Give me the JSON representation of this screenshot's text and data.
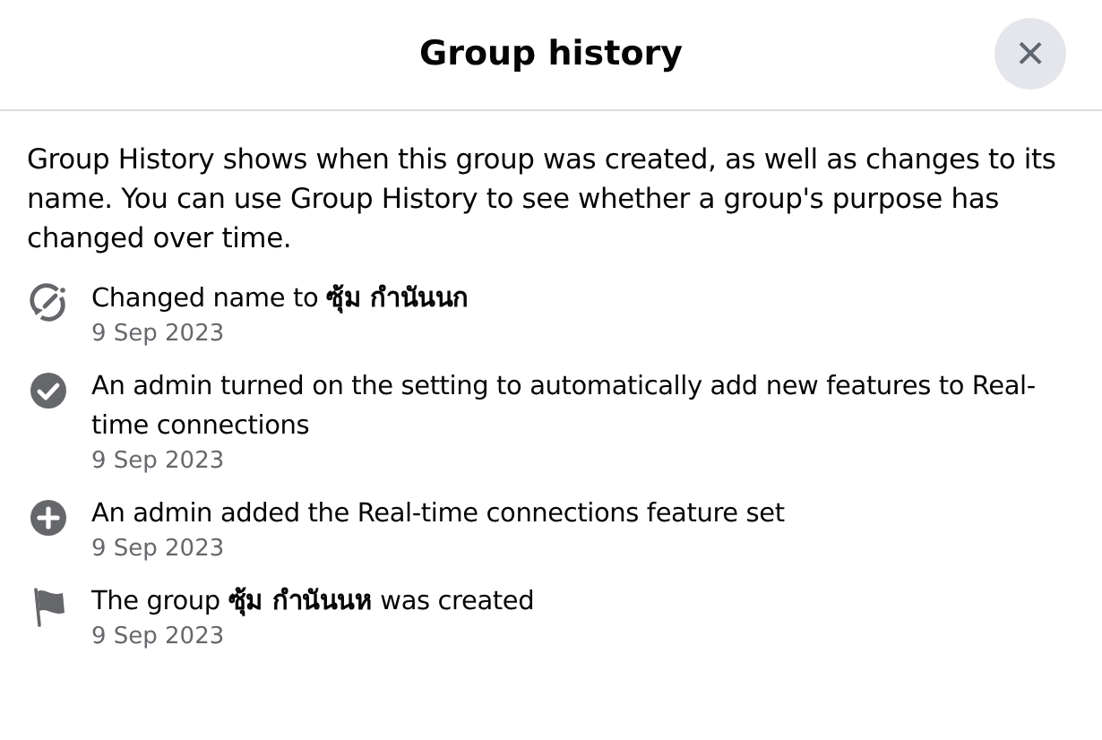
{
  "dialog": {
    "title": "Group history",
    "close_label": "×"
  },
  "description": "Group History shows when this group was created, as well as changes to its name. You can use Group History to see whether a group's purpose has changed over time.",
  "events": [
    {
      "kind": "rename",
      "text": "Changed name to **ซุ้ม กำนันนก**",
      "date": "9 Sep 2023"
    },
    {
      "kind": "check",
      "text": "An admin turned on the setting to automatically add new features to Real-time connections",
      "date": "9 Sep 2023"
    },
    {
      "kind": "add",
      "text": "An admin added the Real-time connections feature set",
      "date": "9 Sep 2023"
    },
    {
      "kind": "flag",
      "text": "The group **ซุ้ม กำนันนห** was created",
      "date": "9 Sep 2023"
    }
  ]
}
